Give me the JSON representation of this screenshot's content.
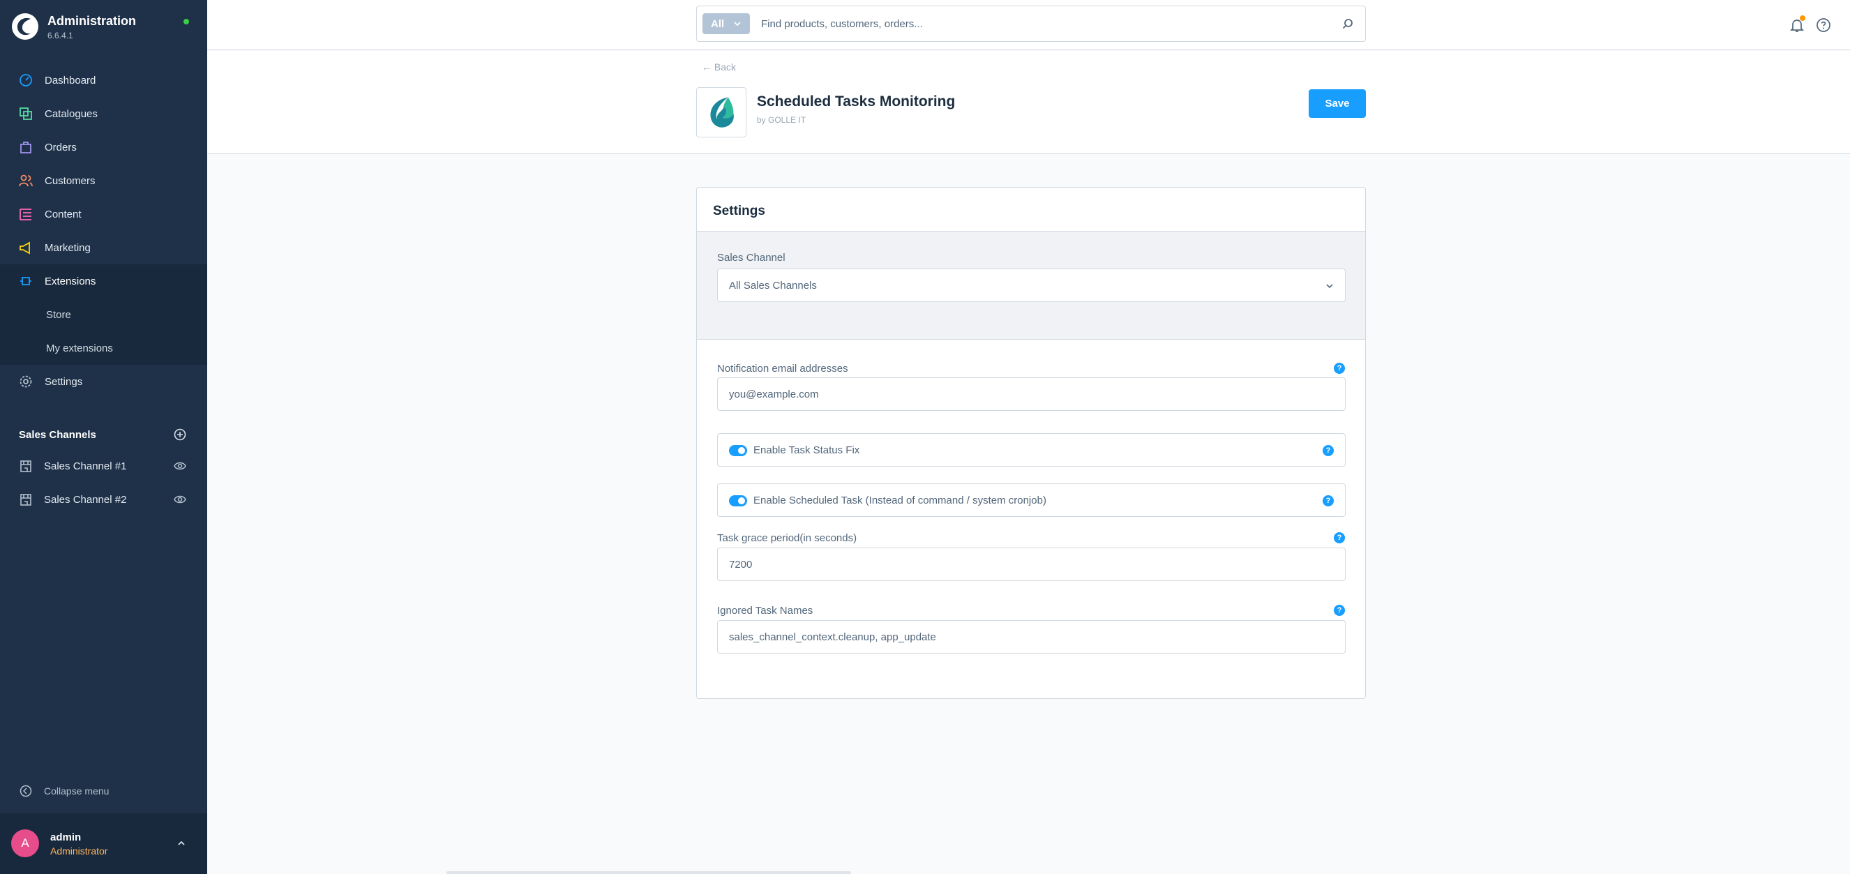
{
  "app": {
    "title": "Administration",
    "version": "6.6.4.1"
  },
  "sidebar": {
    "items": [
      {
        "label": "Dashboard",
        "icon": "dashboard-icon"
      },
      {
        "label": "Catalogues",
        "icon": "catalogues-icon"
      },
      {
        "label": "Orders",
        "icon": "orders-icon"
      },
      {
        "label": "Customers",
        "icon": "customers-icon"
      },
      {
        "label": "Content",
        "icon": "content-icon"
      },
      {
        "label": "Marketing",
        "icon": "marketing-icon"
      },
      {
        "label": "Extensions",
        "icon": "extensions-icon",
        "active": true
      },
      {
        "label": "Store",
        "sub": true
      },
      {
        "label": "My extensions",
        "sub": true
      },
      {
        "label": "Settings",
        "icon": "settings-icon"
      }
    ],
    "sales_channels": {
      "title": "Sales Channels",
      "items": [
        "Sales Channel #1",
        "Sales Channel #2"
      ]
    },
    "collapse_label": "Collapse menu",
    "user": {
      "initial": "A",
      "name": "admin",
      "role": "Administrator"
    }
  },
  "topbar": {
    "search_type": "All",
    "search_placeholder": "Find products, customers, orders..."
  },
  "page": {
    "back_label": "← Back",
    "plugin_name": "Scheduled Tasks Monitoring",
    "plugin_author": "by GOLLE IT",
    "save_label": "Save"
  },
  "settings": {
    "title": "Settings",
    "sales_channel_label": "Sales Channel",
    "sales_channel_value": "All Sales Channels",
    "email_label": "Notification email addresses",
    "email_placeholder": "you@example.com",
    "toggle1_label": "Enable Task Status Fix",
    "toggle1_on": true,
    "toggle2_label": "Enable Scheduled Task (Instead of command / system cronjob)",
    "toggle2_on": true,
    "grace_label": "Task grace period(in seconds)",
    "grace_value": "7200",
    "ignored_label": "Ignored Task Names",
    "ignored_value": "sales_channel_context.cleanup, app_update",
    "help_glyph": "?"
  },
  "colors": {
    "sidebar_bg": "#1e3149",
    "accent": "#189eff",
    "role": "#ffb75d"
  }
}
